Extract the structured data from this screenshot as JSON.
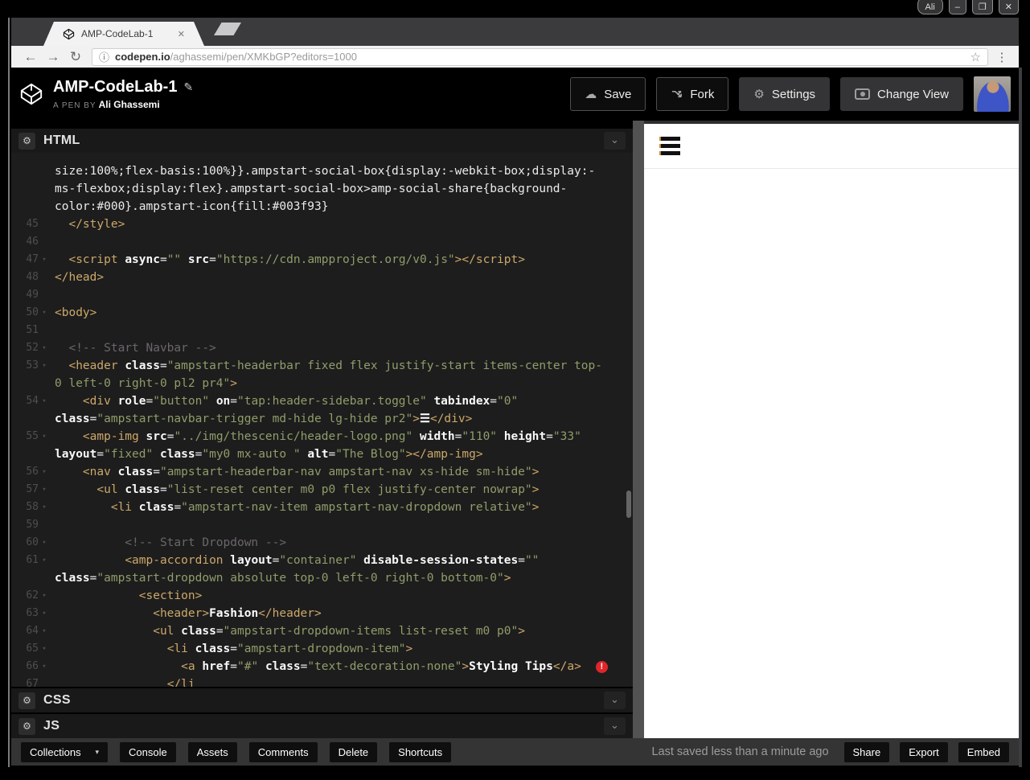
{
  "titlebar": {
    "user": "Ali",
    "minimize": "–",
    "maximize": "❐",
    "close": "✕"
  },
  "browser": {
    "tab_title": "AMP-CodeLab-1",
    "tab_close": "✕",
    "back": "←",
    "forward": "→",
    "reload": "↻",
    "info": "ⓘ",
    "url_host": "codepen.io",
    "url_path": "/aghassemi/pen/XMKbGP?editors=1000",
    "star": "☆",
    "menu": "⋮"
  },
  "header": {
    "title": "AMP-CodeLab-1",
    "edit_icon": "✎",
    "pen_label": "A PEN BY",
    "author": "Ali Ghassemi",
    "save": "Save",
    "fork": "Fork",
    "settings": "Settings",
    "change_view": "Change View",
    "save_icon": "☁",
    "settings_icon": "⚙"
  },
  "panels": {
    "gear_icon": "⚙",
    "chevron_icon": "⌄",
    "html_label": "HTML",
    "css_label": "CSS",
    "js_label": "JS"
  },
  "editor": {
    "error_badge": "!",
    "lines": [
      {
        "n": "",
        "s": [
          [
            "p",
            "size:100%;flex-basis:100%}}.ampstart-social-box{display:-webkit-box;display:-"
          ]
        ]
      },
      {
        "n": "",
        "s": [
          [
            "p",
            "ms-flexbox;display:flex}.ampstart-social-box>amp-social-share{background-"
          ]
        ]
      },
      {
        "n": "",
        "s": [
          [
            "p",
            "color:#000}.ampstart-icon{fill:#003f93}"
          ]
        ]
      },
      {
        "n": "45",
        "s": [
          [
            "t",
            "  </style>"
          ]
        ]
      },
      {
        "n": "46",
        "s": []
      },
      {
        "n": "47",
        "f": 1,
        "s": [
          [
            "p",
            "  "
          ],
          [
            "t",
            "<script"
          ],
          [
            "p",
            " "
          ],
          [
            "a",
            "async"
          ],
          [
            "p",
            "="
          ],
          [
            "s",
            "\"\""
          ],
          [
            "p",
            " "
          ],
          [
            "a",
            "src"
          ],
          [
            "p",
            "="
          ],
          [
            "s",
            "\"https://cdn.ampproject.org/v0.js\""
          ],
          [
            "t",
            "></script>"
          ]
        ]
      },
      {
        "n": "48",
        "s": [
          [
            "t",
            "</head>"
          ]
        ]
      },
      {
        "n": "49",
        "s": []
      },
      {
        "n": "50",
        "f": 1,
        "s": [
          [
            "t",
            "<body>"
          ]
        ]
      },
      {
        "n": "51",
        "s": []
      },
      {
        "n": "52",
        "f": 1,
        "s": [
          [
            "c",
            "  <!-- Start Navbar -->"
          ]
        ]
      },
      {
        "n": "53",
        "f": 1,
        "s": [
          [
            "p",
            "  "
          ],
          [
            "t",
            "<header"
          ],
          [
            "p",
            " "
          ],
          [
            "a",
            "class"
          ],
          [
            "p",
            "="
          ],
          [
            "s",
            "\"ampstart-headerbar fixed flex justify-start items-center top-"
          ]
        ]
      },
      {
        "n": "",
        "s": [
          [
            "s",
            "0 left-0 right-0 pl2 pr4\""
          ],
          [
            "t",
            ">"
          ]
        ]
      },
      {
        "n": "54",
        "f": 1,
        "s": [
          [
            "p",
            "    "
          ],
          [
            "t",
            "<div"
          ],
          [
            "p",
            " "
          ],
          [
            "a",
            "role"
          ],
          [
            "p",
            "="
          ],
          [
            "s",
            "\"button\""
          ],
          [
            "p",
            " "
          ],
          [
            "a",
            "on"
          ],
          [
            "p",
            "="
          ],
          [
            "s",
            "\"tap:header-sidebar.toggle\""
          ],
          [
            "p",
            " "
          ],
          [
            "a",
            "tabindex"
          ],
          [
            "p",
            "="
          ],
          [
            "s",
            "\"0\""
          ]
        ]
      },
      {
        "n": "",
        "s": [
          [
            "a",
            "class"
          ],
          [
            "p",
            "="
          ],
          [
            "s",
            "\"ampstart-navbar-trigger md-hide lg-hide pr2\""
          ],
          [
            "t",
            ">"
          ],
          [
            "w",
            "☰"
          ],
          [
            "t",
            "</div>"
          ]
        ]
      },
      {
        "n": "55",
        "f": 1,
        "s": [
          [
            "p",
            "    "
          ],
          [
            "t",
            "<amp-img"
          ],
          [
            "p",
            " "
          ],
          [
            "a",
            "src"
          ],
          [
            "p",
            "="
          ],
          [
            "s",
            "\"../img/thescenic/header-logo.png\""
          ],
          [
            "p",
            " "
          ],
          [
            "a",
            "width"
          ],
          [
            "p",
            "="
          ],
          [
            "s",
            "\"110\""
          ],
          [
            "p",
            " "
          ],
          [
            "a",
            "height"
          ],
          [
            "p",
            "="
          ],
          [
            "s",
            "\"33\""
          ]
        ]
      },
      {
        "n": "",
        "s": [
          [
            "a",
            "layout"
          ],
          [
            "p",
            "="
          ],
          [
            "s",
            "\"fixed\""
          ],
          [
            "p",
            " "
          ],
          [
            "a",
            "class"
          ],
          [
            "p",
            "="
          ],
          [
            "s",
            "\"my0 mx-auto \""
          ],
          [
            "p",
            " "
          ],
          [
            "a",
            "alt"
          ],
          [
            "p",
            "="
          ],
          [
            "s",
            "\"The Blog\""
          ],
          [
            "t",
            "></amp-img>"
          ]
        ]
      },
      {
        "n": "56",
        "f": 1,
        "s": [
          [
            "p",
            "    "
          ],
          [
            "t",
            "<nav"
          ],
          [
            "p",
            " "
          ],
          [
            "a",
            "class"
          ],
          [
            "p",
            "="
          ],
          [
            "s",
            "\"ampstart-headerbar-nav ampstart-nav xs-hide sm-hide\""
          ],
          [
            "t",
            ">"
          ]
        ]
      },
      {
        "n": "57",
        "f": 1,
        "s": [
          [
            "p",
            "      "
          ],
          [
            "t",
            "<ul"
          ],
          [
            "p",
            " "
          ],
          [
            "a",
            "class"
          ],
          [
            "p",
            "="
          ],
          [
            "s",
            "\"list-reset center m0 p0 flex justify-center nowrap\""
          ],
          [
            "t",
            ">"
          ]
        ]
      },
      {
        "n": "58",
        "f": 1,
        "s": [
          [
            "p",
            "        "
          ],
          [
            "t",
            "<li"
          ],
          [
            "p",
            " "
          ],
          [
            "a",
            "class"
          ],
          [
            "p",
            "="
          ],
          [
            "s",
            "\"ampstart-nav-item ampstart-nav-dropdown relative\""
          ],
          [
            "t",
            ">"
          ]
        ]
      },
      {
        "n": "59",
        "s": []
      },
      {
        "n": "60",
        "f": 1,
        "s": [
          [
            "c",
            "          <!-- Start Dropdown -->"
          ]
        ]
      },
      {
        "n": "61",
        "f": 1,
        "s": [
          [
            "p",
            "          "
          ],
          [
            "t",
            "<amp-accordion"
          ],
          [
            "p",
            " "
          ],
          [
            "a",
            "layout"
          ],
          [
            "p",
            "="
          ],
          [
            "s",
            "\"container\""
          ],
          [
            "p",
            " "
          ],
          [
            "a",
            "disable-session-states"
          ],
          [
            "p",
            "="
          ],
          [
            "s",
            "\"\""
          ]
        ]
      },
      {
        "n": "",
        "s": [
          [
            "a",
            "class"
          ],
          [
            "p",
            "="
          ],
          [
            "s",
            "\"ampstart-dropdown absolute top-0 left-0 right-0 bottom-0\""
          ],
          [
            "t",
            ">"
          ]
        ]
      },
      {
        "n": "62",
        "f": 1,
        "s": [
          [
            "p",
            "            "
          ],
          [
            "t",
            "<section>"
          ]
        ]
      },
      {
        "n": "63",
        "f": 1,
        "s": [
          [
            "p",
            "              "
          ],
          [
            "t",
            "<header>"
          ],
          [
            "w",
            "Fashion"
          ],
          [
            "t",
            "</header>"
          ]
        ]
      },
      {
        "n": "64",
        "f": 1,
        "s": [
          [
            "p",
            "              "
          ],
          [
            "t",
            "<ul"
          ],
          [
            "p",
            " "
          ],
          [
            "a",
            "class"
          ],
          [
            "p",
            "="
          ],
          [
            "s",
            "\"ampstart-dropdown-items list-reset m0 p0\""
          ],
          [
            "t",
            ">"
          ]
        ]
      },
      {
        "n": "65",
        "f": 1,
        "s": [
          [
            "p",
            "                "
          ],
          [
            "t",
            "<li"
          ],
          [
            "p",
            " "
          ],
          [
            "a",
            "class"
          ],
          [
            "p",
            "="
          ],
          [
            "s",
            "\"ampstart-dropdown-item\""
          ],
          [
            "t",
            ">"
          ]
        ]
      },
      {
        "n": "66",
        "f": 1,
        "e": 1,
        "s": [
          [
            "p",
            "                  "
          ],
          [
            "t",
            "<a"
          ],
          [
            "p",
            " "
          ],
          [
            "a",
            "href"
          ],
          [
            "p",
            "="
          ],
          [
            "s",
            "\"#\""
          ],
          [
            "p",
            " "
          ],
          [
            "a",
            "class"
          ],
          [
            "p",
            "="
          ],
          [
            "s",
            "\"text-decoration-none\""
          ],
          [
            "t",
            ">"
          ],
          [
            "w",
            "Styling Tips"
          ],
          [
            "t",
            "</a>"
          ]
        ]
      },
      {
        "n": "67",
        "s": [
          [
            "p",
            "                "
          ],
          [
            "t",
            "</li"
          ]
        ]
      }
    ]
  },
  "footer": {
    "collections": "Collections",
    "caret": "▾",
    "console": "Console",
    "assets": "Assets",
    "comments": "Comments",
    "delete": "Delete",
    "shortcuts": "Shortcuts",
    "status": "Last saved less than a minute ago",
    "share": "Share",
    "export": "Export",
    "embed": "Embed"
  },
  "colors": {
    "accent_tag": "#cda869",
    "accent_string": "#8f9d6a",
    "error_red": "#e0262b",
    "editor_bg": "#1d1d1d",
    "footer_bg": "#343434"
  }
}
